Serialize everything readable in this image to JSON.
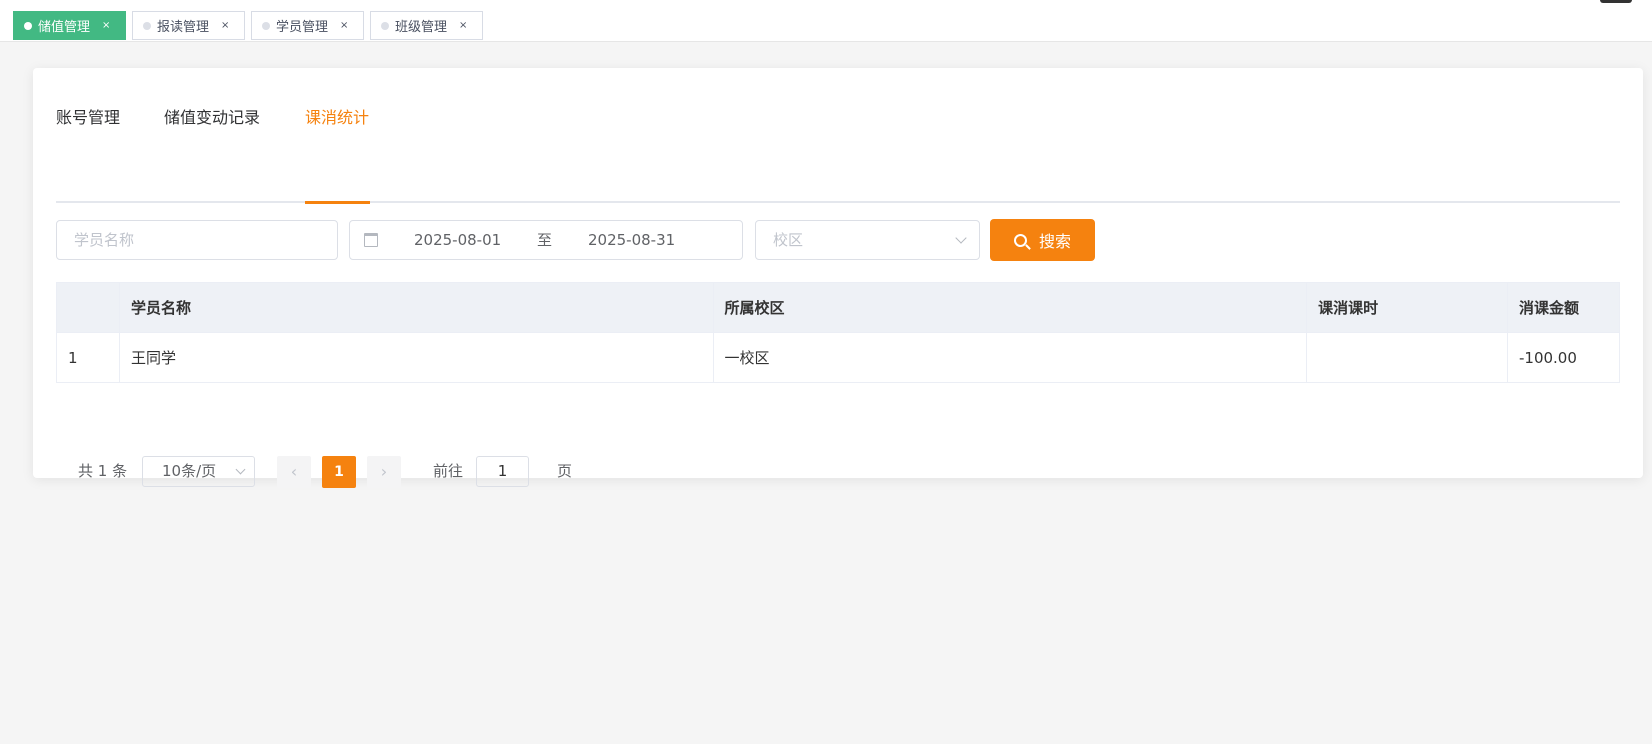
{
  "tags": [
    {
      "label": "储值管理",
      "close": "×"
    },
    {
      "label": "报读管理",
      "close": "×"
    },
    {
      "label": "学员管理",
      "close": "×"
    },
    {
      "label": "班级管理",
      "close": "×"
    }
  ],
  "tabs": [
    {
      "label": "账号管理"
    },
    {
      "label": "储值变动记录"
    },
    {
      "label": "课消统计"
    }
  ],
  "filters": {
    "name_placeholder": "学员名称",
    "start_date": "2025-08-01",
    "date_separator": "至",
    "end_date": "2025-08-31",
    "campus_placeholder": "校区",
    "search_label": "搜索"
  },
  "table": {
    "headers": [
      "",
      "学员名称",
      "所属校区",
      "课消课时",
      "消课金额"
    ],
    "rows": [
      [
        "1",
        "王同学",
        "一校区",
        "",
        "-100.00"
      ]
    ]
  },
  "pagination": {
    "total": "共 1 条",
    "page_size": "10条/页",
    "prev": "‹",
    "current": "1",
    "next": "›",
    "goto_label": "前往",
    "goto_value": "1",
    "page_suffix": "页"
  },
  "colors": {
    "accent": "#f5820f",
    "active_tag": "#42b983"
  }
}
